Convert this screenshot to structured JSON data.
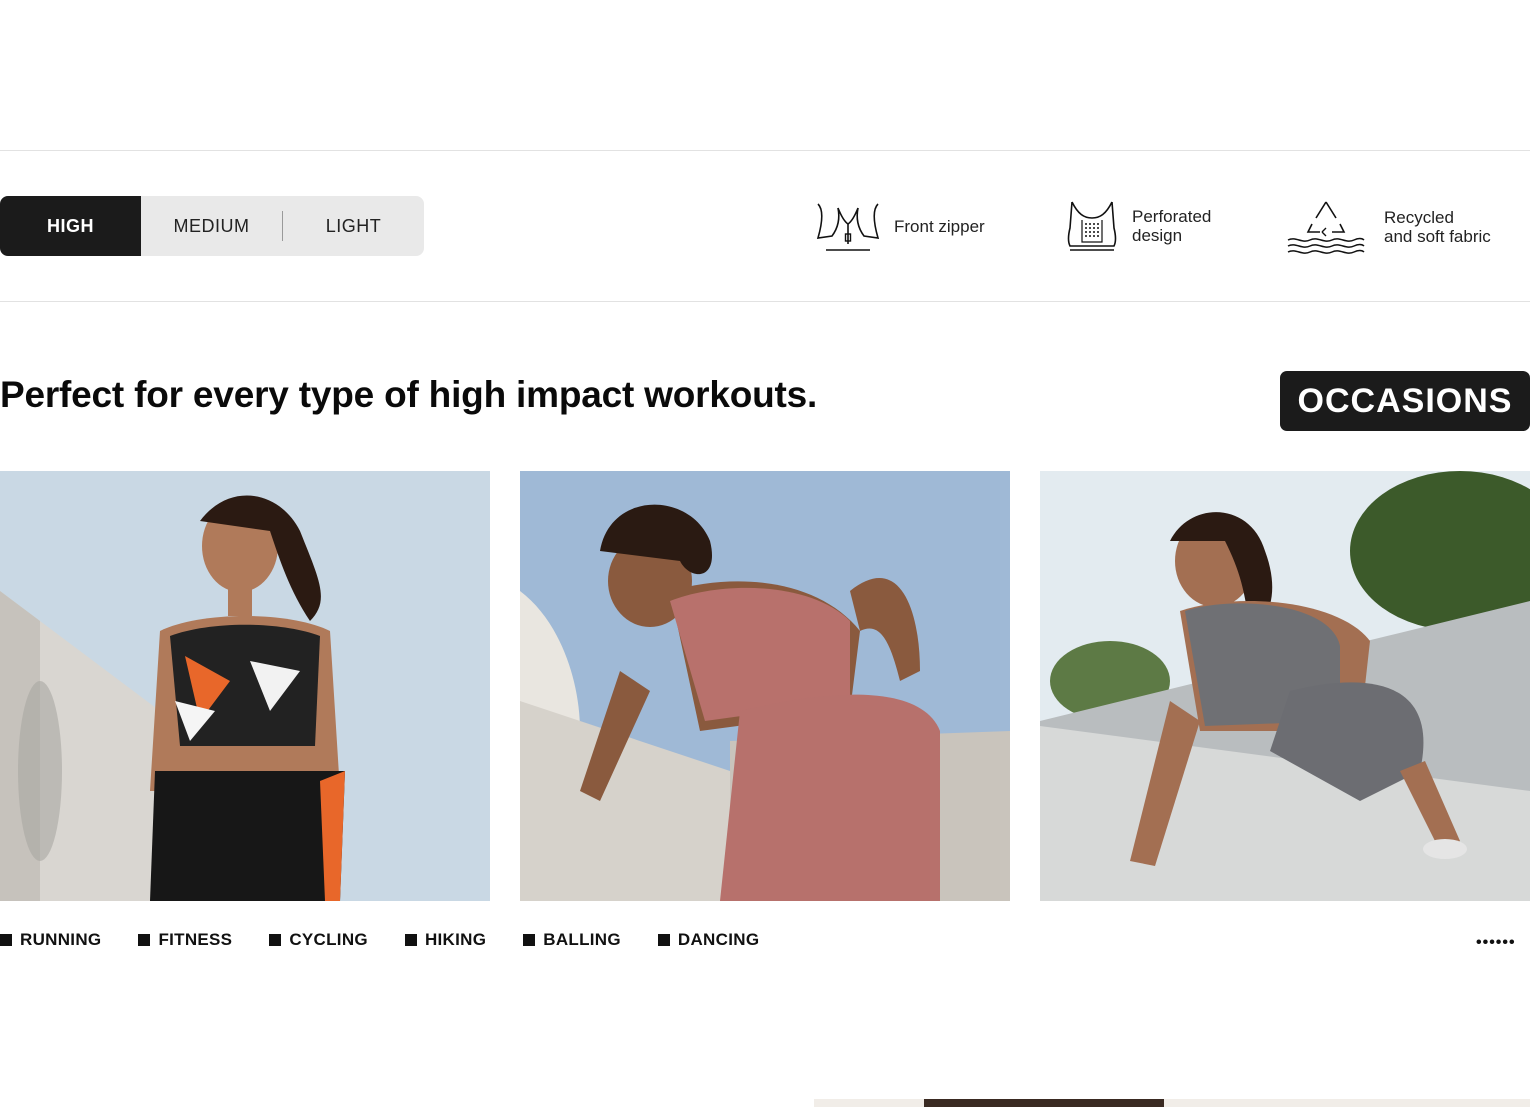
{
  "levels": {
    "items": [
      "HIGH",
      "MEDIUM",
      "LIGHT"
    ],
    "selected": "HIGH"
  },
  "features": [
    {
      "icon": "zipper-icon",
      "label": "Front zipper"
    },
    {
      "icon": "perforated-bra-icon",
      "label": "Perforated\ndesign"
    },
    {
      "icon": "recycle-icon",
      "label": "Recycled\nand soft fabric"
    }
  ],
  "headline": "Perfect for every type of high impact workouts.",
  "badge": "OCCASIONS",
  "photos": [
    {
      "name": "running-photo",
      "bra_color": "#222222",
      "legging_color": "#171717"
    },
    {
      "name": "balling-photo",
      "bra_color": "#b8716c",
      "legging_color": "#b7716c"
    },
    {
      "name": "fitness-photo",
      "bra_color": "#6f7074",
      "legging_color": "#6c6d72"
    }
  ],
  "activities": [
    "RUNNING",
    "FITNESS",
    "CYCLING",
    "HIKING",
    "BALLING",
    "DANCING"
  ],
  "more": "••••••",
  "colors": {
    "active_bg": "#1b1b1b",
    "segment_bg": "#e9e9e9"
  }
}
